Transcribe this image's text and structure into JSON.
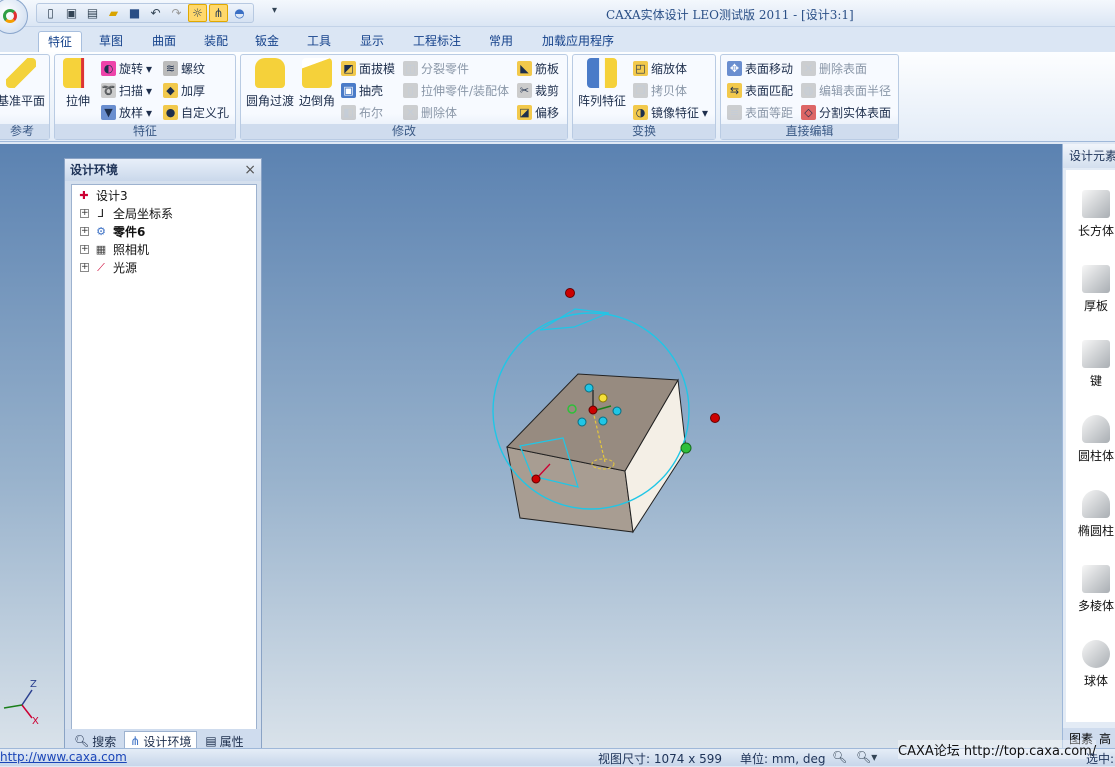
{
  "window": {
    "title": "CAXA实体设计 LEO测试版 2011 - [设计3:1]"
  },
  "qat": {
    "icons": [
      "new-file-icon",
      "new-design-icon",
      "new-drawing-icon",
      "open-folder-icon",
      "save-icon",
      "undo-icon",
      "redo-icon",
      "smart-select-icon",
      "tree-icon",
      "hat-icon"
    ],
    "more": "▾"
  },
  "tabs": [
    "特征",
    "草图",
    "曲面",
    "装配",
    "钣金",
    "工具",
    "显示",
    "工程标注",
    "常用",
    "加载应用程序"
  ],
  "ribbon": {
    "reference": {
      "caption": "参考",
      "big": "基准平面"
    },
    "feature": {
      "caption": "特征",
      "big": "拉伸",
      "items": [
        "旋转",
        "扫描",
        "放样",
        "螺纹",
        "加厚",
        "自定义孔"
      ]
    },
    "modify": {
      "caption": "修改",
      "big": [
        "圆角过渡",
        "边倒角"
      ],
      "items": [
        "面拔模",
        "抽壳",
        "布尔",
        "分裂零件",
        "拉伸零件/装配体",
        "删除体",
        "筋板",
        "裁剪",
        "偏移"
      ]
    },
    "transform": {
      "caption": "变换",
      "big": "阵列特征",
      "items": [
        "缩放体",
        "拷贝体",
        "镜像特征"
      ]
    },
    "direct_edit": {
      "caption": "直接编辑",
      "items": [
        "表面移动",
        "表面匹配",
        "表面等距",
        "删除表面",
        "编辑表面半径",
        "分割实体表面"
      ]
    }
  },
  "design_panel": {
    "title": "设计环境",
    "close": "×",
    "tree": [
      {
        "label": "设计3",
        "bold": false
      },
      {
        "label": "全局坐标系",
        "bold": false
      },
      {
        "label": "零件6",
        "bold": true
      },
      {
        "label": "照相机",
        "bold": false
      },
      {
        "label": "光源",
        "bold": false
      }
    ],
    "expander": "+",
    "tabs": [
      "搜索",
      "设计环境",
      "属性"
    ]
  },
  "right_panel": {
    "title": "设计元素",
    "items": [
      "长方体",
      "厚板",
      "键",
      "圆柱体",
      "椭圆柱",
      "多棱体",
      "球体"
    ],
    "tabs": [
      "图素",
      "高"
    ]
  },
  "axes": {
    "z": "Z",
    "x": "X"
  },
  "status": {
    "link": "http://www.caxa.com",
    "view_size": "视图尺寸: 1074 x 599",
    "units": "单位: mm, deg",
    "selection": "选中: ",
    "forum": "CAXA论坛 http://top.caxa.com/"
  },
  "colors": {
    "accent": "#15428b",
    "viewport_top": "#5b82b1",
    "viewport_bottom": "#d9e2ea",
    "handle_cyan": "#20c6e6"
  }
}
